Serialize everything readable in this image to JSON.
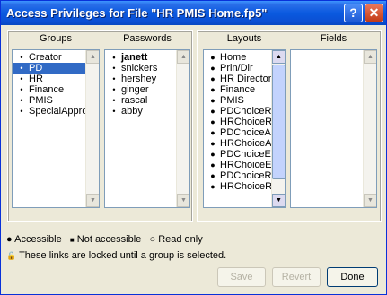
{
  "window": {
    "title": "Access Privileges for File \"HR PMIS Home.fp5\"",
    "help_label": "?",
    "close_label": "✕"
  },
  "columns": {
    "groups_header": "Groups",
    "passwords_header": "Passwords",
    "layouts_header": "Layouts",
    "fields_header": "Fields"
  },
  "groups": [
    "Creator",
    "PD",
    "HR",
    "Finance",
    "PMIS",
    "SpecialAppro"
  ],
  "groups_selected_index": 1,
  "passwords": [
    "janett",
    "snickers",
    "hershey",
    "ginger",
    "rascal",
    "abby"
  ],
  "passwords_bold_index": 0,
  "layouts": [
    "Home",
    "Prin/Dir",
    "HR Director",
    "Finance",
    "PMIS",
    "PDChoiceRe",
    "HRChoiceRe",
    "PDChoiceAs",
    "HRChoiceAs",
    "PDChoiceEx",
    "HRChoiceEx",
    "PDChoiceRe",
    "HRChoiceRe"
  ],
  "legend": {
    "accessible": "Accessible",
    "not_accessible": "Not accessible",
    "read_only": "Read only"
  },
  "note": "These links are locked until a group is selected.",
  "buttons": {
    "save": "Save",
    "revert": "Revert",
    "done": "Done"
  }
}
